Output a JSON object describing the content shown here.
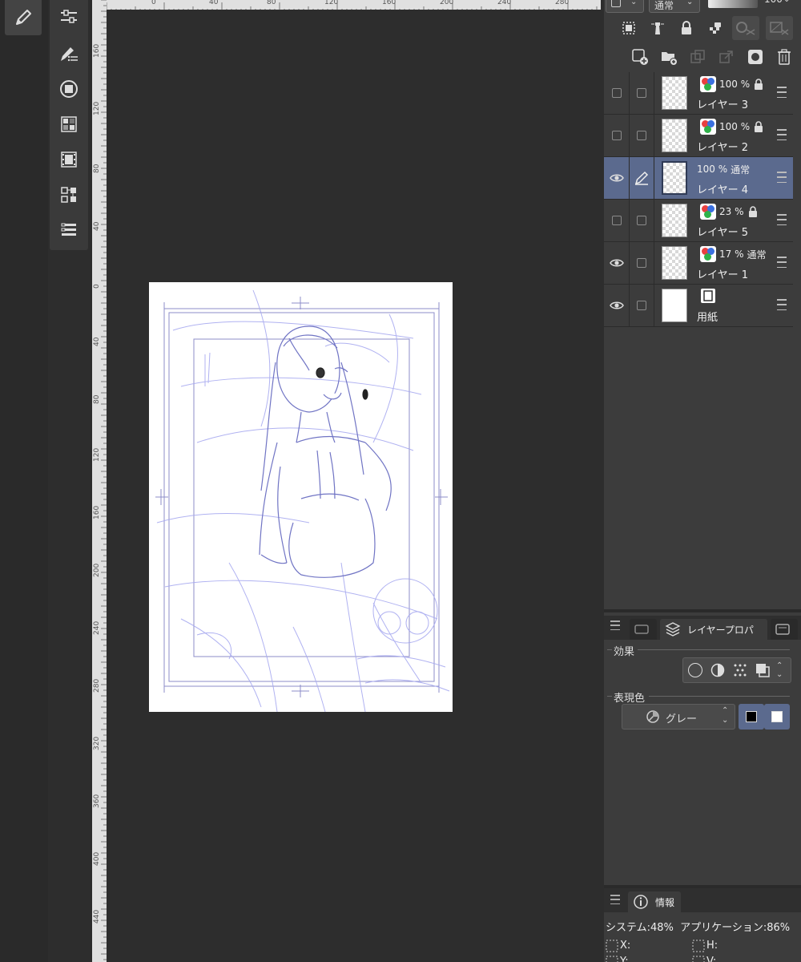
{
  "app": {
    "canvas_bg": "#2d2d2d",
    "accent": "#5b6a8e"
  },
  "tools": {
    "active": "pencil-icon",
    "sub_tools": [
      "sliders-icon",
      "brush-list-icon",
      "material-icon",
      "grid-palette-icon",
      "film-icon",
      "nodes-icon",
      "layers-list-icon"
    ]
  },
  "rulers": {
    "top_labels": [
      "0",
      "40",
      "80",
      "120",
      "160",
      "200",
      "240",
      "280"
    ],
    "left_labels": [
      "160",
      "120",
      "80",
      "40",
      "0",
      "40",
      "80",
      "120",
      "160",
      "200",
      "240",
      "280",
      "320",
      "360",
      "400",
      "440"
    ]
  },
  "layer_panel": {
    "blend_mode": "通常",
    "opacity": "100",
    "layers": [
      {
        "name": "レイヤー 3",
        "opacity": "100 %",
        "blend": "",
        "visible": false,
        "locked": true,
        "selected": false,
        "has_color_icon": true,
        "paper": false
      },
      {
        "name": "レイヤー 2",
        "opacity": "100 %",
        "blend": "",
        "visible": false,
        "locked": true,
        "selected": false,
        "has_color_icon": true,
        "paper": false
      },
      {
        "name": "レイヤー 4",
        "opacity": "100 %",
        "blend": "通常",
        "visible": true,
        "locked": false,
        "selected": true,
        "has_color_icon": false,
        "paper": false
      },
      {
        "name": "レイヤー 5",
        "opacity": "23 %",
        "blend": "",
        "visible": false,
        "locked": true,
        "selected": false,
        "has_color_icon": true,
        "paper": false
      },
      {
        "name": "レイヤー 1",
        "opacity": "17 %",
        "blend": "通常",
        "visible": true,
        "locked": false,
        "selected": false,
        "has_color_icon": true,
        "paper": false
      },
      {
        "name": "用紙",
        "opacity": "",
        "blend": "",
        "visible": true,
        "locked": false,
        "selected": false,
        "has_color_icon": false,
        "paper": true
      }
    ]
  },
  "property_panel": {
    "tab_label": "レイヤープロパ",
    "effect_label": "効果",
    "expression_color_label": "表現色",
    "expression_color_value": "グレー"
  },
  "info_panel": {
    "tab_label": "情報",
    "memory_text": "システム:48%  アプリケーション:86%",
    "x_label": "X:",
    "h_label": "H:",
    "y_label": "Y:",
    "v_label": "V:"
  }
}
